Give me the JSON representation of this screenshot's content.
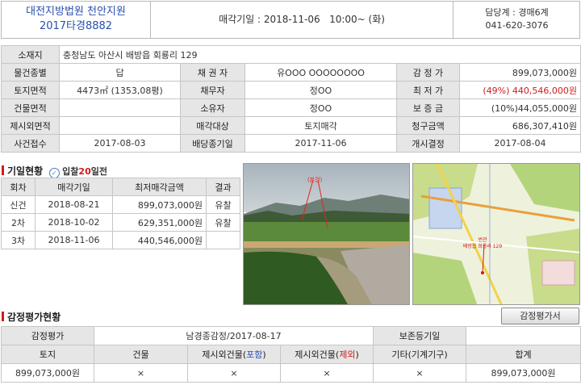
{
  "header": {
    "court": "대전지방법원 천안지원",
    "case_no": "2017타경8882",
    "date_label": "매각기일 : 2018-11-06   10:00~ (화)",
    "dept": "담당계 : 경매6계",
    "phone": "041-620-3076"
  },
  "info": {
    "address_label": "소재지",
    "address": "충청남도 아산시 배방읍 회룡리 129",
    "rows": [
      [
        "물건종별",
        "답",
        "채 권 자",
        "유OOO OOOOOOOO",
        "감 정 가",
        "899,073,000원"
      ],
      [
        "토지면적",
        "4473㎡ (1353,08평)",
        "채무자",
        "정OO",
        "최 저 가",
        "(49%) 440,546,000원"
      ],
      [
        "건물면적",
        "",
        "소유자",
        "정OO",
        "보 증 금",
        "(10%)44,055,000원"
      ],
      [
        "제시외면적",
        "",
        "매각대상",
        "토지매각",
        "청구금액",
        "686,307,410원"
      ],
      [
        "사건접수",
        "2017-08-03",
        "배당종기일",
        "2017-11-06",
        "개시결정",
        "2017-08-04"
      ]
    ]
  },
  "history": {
    "title": "기일현황",
    "days_prefix": "입찰",
    "days_num": "20",
    "days_suffix": "일전",
    "headers": [
      "회차",
      "매각기일",
      "최저매각금액",
      "결과"
    ],
    "rows": [
      [
        "신건",
        "2018-08-21",
        "899,073,000원",
        "유찰"
      ],
      [
        "2차",
        "2018-10-02",
        "629,351,000원",
        "유찰"
      ],
      [
        "3차",
        "2018-11-06",
        "440,546,000원",
        ""
      ]
    ]
  },
  "photo": {
    "tag": "(본건)"
  },
  "map": {
    "label1": "번관",
    "label2": "배방읍 희룡리 129"
  },
  "appraisal": {
    "title": "감정평가현황",
    "button": "감정평가서",
    "row1": [
      "감정평가",
      "남경종감정/2017-08-17",
      "보존등기일",
      ""
    ],
    "headers": [
      "토지",
      "건물",
      "제시외건물(",
      "포함",
      ")",
      "제시외건물(",
      "제외",
      ")",
      "기타(기계기구)",
      "합계"
    ],
    "values": [
      "899,073,000원",
      "×",
      "×",
      "×",
      "×",
      "899,073,000원"
    ]
  },
  "colors": {
    "title_blue": "#2a4fae",
    "accent_red": "#d11a1a",
    "label_bg": "#e6e6e6"
  }
}
